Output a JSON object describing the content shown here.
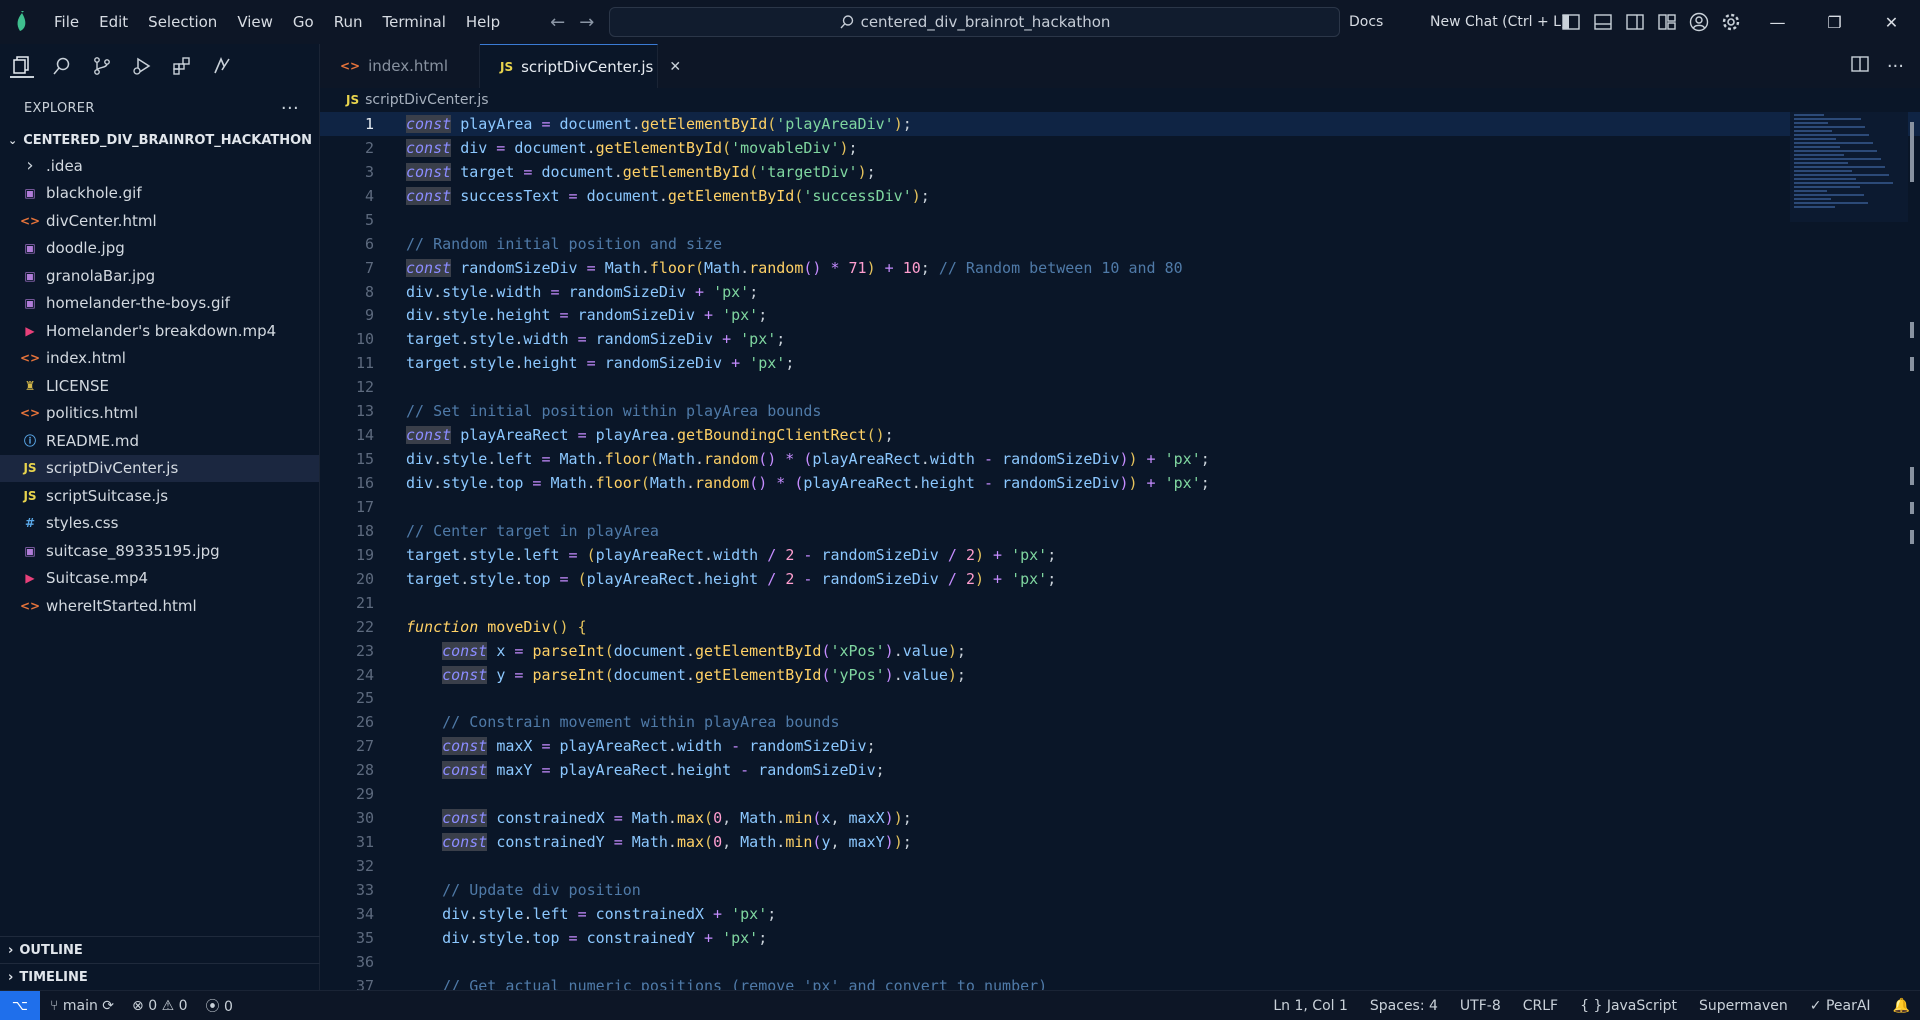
{
  "menu": [
    "File",
    "Edit",
    "Selection",
    "View",
    "Go",
    "Run",
    "Terminal",
    "Help"
  ],
  "search": {
    "text": "centered_div_brainrot_hackathon"
  },
  "header": {
    "docs": "Docs",
    "new_chat": "New Chat (Ctrl + L)"
  },
  "explorer": {
    "title": "EXPLORER",
    "more": "···",
    "folder": "CENTERED_DIV_BRAINROT_HACKATHON",
    "files": [
      {
        "name": ".idea",
        "icon": "chevron-right-icon",
        "glyph": "›",
        "color": "#c9d1d9"
      },
      {
        "name": "blackhole.gif",
        "icon": "image-icon",
        "glyph": "▣",
        "color": "#b07cd8"
      },
      {
        "name": "divCenter.html",
        "icon": "html-icon",
        "glyph": "<>",
        "color": "#e8743b"
      },
      {
        "name": "doodle.jpg",
        "icon": "image-icon",
        "glyph": "▣",
        "color": "#b07cd8"
      },
      {
        "name": "granolaBar.jpg",
        "icon": "image-icon",
        "glyph": "▣",
        "color": "#b07cd8"
      },
      {
        "name": "homelander-the-boys.gif",
        "icon": "image-icon",
        "glyph": "▣",
        "color": "#b07cd8"
      },
      {
        "name": "Homelander's breakdown.mp4",
        "icon": "video-icon",
        "glyph": "▶",
        "color": "#e8407a"
      },
      {
        "name": "index.html",
        "icon": "html-icon",
        "glyph": "<>",
        "color": "#e8743b"
      },
      {
        "name": "LICENSE",
        "icon": "license-icon",
        "glyph": "♜",
        "color": "#d4b84a"
      },
      {
        "name": "politics.html",
        "icon": "html-icon",
        "glyph": "<>",
        "color": "#e8743b"
      },
      {
        "name": "README.md",
        "icon": "info-icon",
        "glyph": "ⓘ",
        "color": "#5aa8e8"
      },
      {
        "name": "scriptDivCenter.js",
        "icon": "js-icon",
        "glyph": "JS",
        "color": "#e8d44d"
      },
      {
        "name": "scriptSuitcase.js",
        "icon": "js-icon",
        "glyph": "JS",
        "color": "#e8d44d"
      },
      {
        "name": "styles.css",
        "icon": "css-icon",
        "glyph": "#",
        "color": "#5aa8e8"
      },
      {
        "name": "suitcase_89335195.jpg",
        "icon": "image-icon",
        "glyph": "▣",
        "color": "#b07cd8"
      },
      {
        "name": "Suitcase.mp4",
        "icon": "video-icon",
        "glyph": "▶",
        "color": "#e8407a"
      },
      {
        "name": "whereItStarted.html",
        "icon": "html-icon",
        "glyph": "<>",
        "color": "#e8743b"
      }
    ],
    "outline": "OUTLINE",
    "timeline": "TIMELINE"
  },
  "tabs": [
    {
      "label": "index.html",
      "glyph": "<>",
      "color": "#e8743b",
      "active": false
    },
    {
      "label": "scriptDivCenter.js",
      "glyph": "JS",
      "color": "#e8d44d",
      "active": true
    }
  ],
  "tab_close": "✕",
  "breadcrumb": {
    "glyph": "JS",
    "file": "scriptDivCenter.js"
  },
  "code_lines": [
    [
      [
        "kw",
        "const"
      ],
      [
        "pl",
        " "
      ],
      [
        "var",
        "playArea"
      ],
      [
        "op",
        " = "
      ],
      [
        "var",
        "document"
      ],
      [
        "pl",
        "."
      ],
      [
        "fnc",
        "getElementById"
      ],
      [
        "punc",
        "("
      ],
      [
        "str",
        "'playAreaDiv'"
      ],
      [
        "punc",
        ")"
      ],
      [
        "pl",
        ";"
      ]
    ],
    [
      [
        "kw",
        "const"
      ],
      [
        "pl",
        " "
      ],
      [
        "var",
        "div"
      ],
      [
        "op",
        " = "
      ],
      [
        "var",
        "document"
      ],
      [
        "pl",
        "."
      ],
      [
        "fnc",
        "getElementById"
      ],
      [
        "punc",
        "("
      ],
      [
        "str",
        "'movableDiv'"
      ],
      [
        "punc",
        ")"
      ],
      [
        "pl",
        ";"
      ]
    ],
    [
      [
        "kw",
        "const"
      ],
      [
        "pl",
        " "
      ],
      [
        "var",
        "target"
      ],
      [
        "op",
        " = "
      ],
      [
        "var",
        "document"
      ],
      [
        "pl",
        "."
      ],
      [
        "fnc",
        "getElementById"
      ],
      [
        "punc",
        "("
      ],
      [
        "str",
        "'targetDiv'"
      ],
      [
        "punc",
        ")"
      ],
      [
        "pl",
        ";"
      ]
    ],
    [
      [
        "kw",
        "const"
      ],
      [
        "pl",
        " "
      ],
      [
        "var",
        "successText"
      ],
      [
        "op",
        " = "
      ],
      [
        "var",
        "document"
      ],
      [
        "pl",
        "."
      ],
      [
        "fnc",
        "getElementById"
      ],
      [
        "punc",
        "("
      ],
      [
        "str",
        "'successDiv'"
      ],
      [
        "punc",
        ")"
      ],
      [
        "pl",
        ";"
      ]
    ],
    [],
    [
      [
        "com",
        "// Random initial position and size"
      ]
    ],
    [
      [
        "kw",
        "const"
      ],
      [
        "pl",
        " "
      ],
      [
        "var",
        "randomSizeDiv"
      ],
      [
        "op",
        " = "
      ],
      [
        "var",
        "Math"
      ],
      [
        "pl",
        "."
      ],
      [
        "fnc",
        "floor"
      ],
      [
        "punc",
        "("
      ],
      [
        "var",
        "Math"
      ],
      [
        "pl",
        "."
      ],
      [
        "fnc",
        "random"
      ],
      [
        "op",
        "()"
      ],
      [
        "op",
        " * "
      ],
      [
        "num",
        "71"
      ],
      [
        "punc",
        ")"
      ],
      [
        "op",
        " + "
      ],
      [
        "num",
        "10"
      ],
      [
        "pl",
        "; "
      ],
      [
        "com",
        "// Random between 10 and 80"
      ]
    ],
    [
      [
        "var",
        "div"
      ],
      [
        "pl",
        "."
      ],
      [
        "prop",
        "style"
      ],
      [
        "pl",
        "."
      ],
      [
        "prop",
        "width"
      ],
      [
        "op",
        " = "
      ],
      [
        "var",
        "randomSizeDiv"
      ],
      [
        "op",
        " + "
      ],
      [
        "str",
        "'px'"
      ],
      [
        "pl",
        ";"
      ]
    ],
    [
      [
        "var",
        "div"
      ],
      [
        "pl",
        "."
      ],
      [
        "prop",
        "style"
      ],
      [
        "pl",
        "."
      ],
      [
        "prop",
        "height"
      ],
      [
        "op",
        " = "
      ],
      [
        "var",
        "randomSizeDiv"
      ],
      [
        "op",
        " + "
      ],
      [
        "str",
        "'px'"
      ],
      [
        "pl",
        ";"
      ]
    ],
    [
      [
        "var",
        "target"
      ],
      [
        "pl",
        "."
      ],
      [
        "prop",
        "style"
      ],
      [
        "pl",
        "."
      ],
      [
        "prop",
        "width"
      ],
      [
        "op",
        " = "
      ],
      [
        "var",
        "randomSizeDiv"
      ],
      [
        "op",
        " + "
      ],
      [
        "str",
        "'px'"
      ],
      [
        "pl",
        ";"
      ]
    ],
    [
      [
        "var",
        "target"
      ],
      [
        "pl",
        "."
      ],
      [
        "prop",
        "style"
      ],
      [
        "pl",
        "."
      ],
      [
        "prop",
        "height"
      ],
      [
        "op",
        " = "
      ],
      [
        "var",
        "randomSizeDiv"
      ],
      [
        "op",
        " + "
      ],
      [
        "str",
        "'px'"
      ],
      [
        "pl",
        ";"
      ]
    ],
    [],
    [
      [
        "com",
        "// Set initial position within playArea bounds"
      ]
    ],
    [
      [
        "kw",
        "const"
      ],
      [
        "pl",
        " "
      ],
      [
        "var",
        "playAreaRect"
      ],
      [
        "op",
        " = "
      ],
      [
        "var",
        "playArea"
      ],
      [
        "pl",
        "."
      ],
      [
        "fnc",
        "getBoundingClientRect"
      ],
      [
        "punc",
        "()"
      ],
      [
        "pl",
        ";"
      ]
    ],
    [
      [
        "var",
        "div"
      ],
      [
        "pl",
        "."
      ],
      [
        "prop",
        "style"
      ],
      [
        "pl",
        "."
      ],
      [
        "prop",
        "left"
      ],
      [
        "op",
        " = "
      ],
      [
        "var",
        "Math"
      ],
      [
        "pl",
        "."
      ],
      [
        "fnc",
        "floor"
      ],
      [
        "punc",
        "("
      ],
      [
        "var",
        "Math"
      ],
      [
        "pl",
        "."
      ],
      [
        "fnc",
        "random"
      ],
      [
        "op",
        "()"
      ],
      [
        "op",
        " * "
      ],
      [
        "op",
        "("
      ],
      [
        "var",
        "playAreaRect"
      ],
      [
        "pl",
        "."
      ],
      [
        "prop",
        "width"
      ],
      [
        "op",
        " - "
      ],
      [
        "var",
        "randomSizeDiv"
      ],
      [
        "op",
        ")"
      ],
      [
        "punc",
        ")"
      ],
      [
        "op",
        " + "
      ],
      [
        "str",
        "'px'"
      ],
      [
        "pl",
        ";"
      ]
    ],
    [
      [
        "var",
        "div"
      ],
      [
        "pl",
        "."
      ],
      [
        "prop",
        "style"
      ],
      [
        "pl",
        "."
      ],
      [
        "prop",
        "top"
      ],
      [
        "op",
        " = "
      ],
      [
        "var",
        "Math"
      ],
      [
        "pl",
        "."
      ],
      [
        "fnc",
        "floor"
      ],
      [
        "punc",
        "("
      ],
      [
        "var",
        "Math"
      ],
      [
        "pl",
        "."
      ],
      [
        "fnc",
        "random"
      ],
      [
        "op",
        "()"
      ],
      [
        "op",
        " * "
      ],
      [
        "op",
        "("
      ],
      [
        "var",
        "playAreaRect"
      ],
      [
        "pl",
        "."
      ],
      [
        "prop",
        "height"
      ],
      [
        "op",
        " - "
      ],
      [
        "var",
        "randomSizeDiv"
      ],
      [
        "op",
        ")"
      ],
      [
        "punc",
        ")"
      ],
      [
        "op",
        " + "
      ],
      [
        "str",
        "'px'"
      ],
      [
        "pl",
        ";"
      ]
    ],
    [],
    [
      [
        "com",
        "// Center target in playArea"
      ]
    ],
    [
      [
        "var",
        "target"
      ],
      [
        "pl",
        "."
      ],
      [
        "prop",
        "style"
      ],
      [
        "pl",
        "."
      ],
      [
        "prop",
        "left"
      ],
      [
        "op",
        " = "
      ],
      [
        "punc",
        "("
      ],
      [
        "var",
        "playAreaRect"
      ],
      [
        "pl",
        "."
      ],
      [
        "prop",
        "width"
      ],
      [
        "op",
        " / "
      ],
      [
        "num",
        "2"
      ],
      [
        "op",
        " - "
      ],
      [
        "var",
        "randomSizeDiv"
      ],
      [
        "op",
        " / "
      ],
      [
        "num",
        "2"
      ],
      [
        "punc",
        ")"
      ],
      [
        "op",
        " + "
      ],
      [
        "str",
        "'px'"
      ],
      [
        "pl",
        ";"
      ]
    ],
    [
      [
        "var",
        "target"
      ],
      [
        "pl",
        "."
      ],
      [
        "prop",
        "style"
      ],
      [
        "pl",
        "."
      ],
      [
        "prop",
        "top"
      ],
      [
        "op",
        " = "
      ],
      [
        "punc",
        "("
      ],
      [
        "var",
        "playAreaRect"
      ],
      [
        "pl",
        "."
      ],
      [
        "prop",
        "height"
      ],
      [
        "op",
        " / "
      ],
      [
        "num",
        "2"
      ],
      [
        "op",
        " - "
      ],
      [
        "var",
        "randomSizeDiv"
      ],
      [
        "op",
        " / "
      ],
      [
        "num",
        "2"
      ],
      [
        "punc",
        ")"
      ],
      [
        "op",
        " + "
      ],
      [
        "str",
        "'px'"
      ],
      [
        "pl",
        ";"
      ]
    ],
    [],
    [
      [
        "fn-kw",
        "function"
      ],
      [
        "pl",
        " "
      ],
      [
        "fnc",
        "moveDiv"
      ],
      [
        "punc",
        "() {"
      ]
    ],
    [
      [
        "pl",
        "    "
      ],
      [
        "kw",
        "const"
      ],
      [
        "pl",
        " "
      ],
      [
        "var",
        "x"
      ],
      [
        "op",
        " = "
      ],
      [
        "fnc",
        "parseInt"
      ],
      [
        "punc",
        "("
      ],
      [
        "var",
        "document"
      ],
      [
        "pl",
        "."
      ],
      [
        "fnc",
        "getElementById"
      ],
      [
        "op",
        "("
      ],
      [
        "str",
        "'xPos'"
      ],
      [
        "op",
        ")"
      ],
      [
        "pl",
        "."
      ],
      [
        "prop",
        "value"
      ],
      [
        "punc",
        ")"
      ],
      [
        "pl",
        ";"
      ]
    ],
    [
      [
        "pl",
        "    "
      ],
      [
        "kw",
        "const"
      ],
      [
        "pl",
        " "
      ],
      [
        "var",
        "y"
      ],
      [
        "op",
        " = "
      ],
      [
        "fnc",
        "parseInt"
      ],
      [
        "punc",
        "("
      ],
      [
        "var",
        "document"
      ],
      [
        "pl",
        "."
      ],
      [
        "fnc",
        "getElementById"
      ],
      [
        "op",
        "("
      ],
      [
        "str",
        "'yPos'"
      ],
      [
        "op",
        ")"
      ],
      [
        "pl",
        "."
      ],
      [
        "prop",
        "value"
      ],
      [
        "punc",
        ")"
      ],
      [
        "pl",
        ";"
      ]
    ],
    [],
    [
      [
        "pl",
        "    "
      ],
      [
        "com",
        "// Constrain movement within playArea bounds"
      ]
    ],
    [
      [
        "pl",
        "    "
      ],
      [
        "kw",
        "const"
      ],
      [
        "pl",
        " "
      ],
      [
        "var",
        "maxX"
      ],
      [
        "op",
        " = "
      ],
      [
        "var",
        "playAreaRect"
      ],
      [
        "pl",
        "."
      ],
      [
        "prop",
        "width"
      ],
      [
        "op",
        " - "
      ],
      [
        "var",
        "randomSizeDiv"
      ],
      [
        "pl",
        ";"
      ]
    ],
    [
      [
        "pl",
        "    "
      ],
      [
        "kw",
        "const"
      ],
      [
        "pl",
        " "
      ],
      [
        "var",
        "maxY"
      ],
      [
        "op",
        " = "
      ],
      [
        "var",
        "playAreaRect"
      ],
      [
        "pl",
        "."
      ],
      [
        "prop",
        "height"
      ],
      [
        "op",
        " - "
      ],
      [
        "var",
        "randomSizeDiv"
      ],
      [
        "pl",
        ";"
      ]
    ],
    [],
    [
      [
        "pl",
        "    "
      ],
      [
        "kw",
        "const"
      ],
      [
        "pl",
        " "
      ],
      [
        "var",
        "constrainedX"
      ],
      [
        "op",
        " = "
      ],
      [
        "var",
        "Math"
      ],
      [
        "pl",
        "."
      ],
      [
        "fnc",
        "max"
      ],
      [
        "punc",
        "("
      ],
      [
        "num",
        "0"
      ],
      [
        "pl",
        ", "
      ],
      [
        "var",
        "Math"
      ],
      [
        "pl",
        "."
      ],
      [
        "fnc",
        "min"
      ],
      [
        "op",
        "("
      ],
      [
        "var",
        "x"
      ],
      [
        "pl",
        ", "
      ],
      [
        "var",
        "maxX"
      ],
      [
        "op",
        ")"
      ],
      [
        "punc",
        ")"
      ],
      [
        "pl",
        ";"
      ]
    ],
    [
      [
        "pl",
        "    "
      ],
      [
        "kw",
        "const"
      ],
      [
        "pl",
        " "
      ],
      [
        "var",
        "constrainedY"
      ],
      [
        "op",
        " = "
      ],
      [
        "var",
        "Math"
      ],
      [
        "pl",
        "."
      ],
      [
        "fnc",
        "max"
      ],
      [
        "punc",
        "("
      ],
      [
        "num",
        "0"
      ],
      [
        "pl",
        ", "
      ],
      [
        "var",
        "Math"
      ],
      [
        "pl",
        "."
      ],
      [
        "fnc",
        "min"
      ],
      [
        "op",
        "("
      ],
      [
        "var",
        "y"
      ],
      [
        "pl",
        ", "
      ],
      [
        "var",
        "maxY"
      ],
      [
        "op",
        ")"
      ],
      [
        "punc",
        ")"
      ],
      [
        "pl",
        ";"
      ]
    ],
    [],
    [
      [
        "pl",
        "    "
      ],
      [
        "com",
        "// Update div position"
      ]
    ],
    [
      [
        "pl",
        "    "
      ],
      [
        "var",
        "div"
      ],
      [
        "pl",
        "."
      ],
      [
        "prop",
        "style"
      ],
      [
        "pl",
        "."
      ],
      [
        "prop",
        "left"
      ],
      [
        "op",
        " = "
      ],
      [
        "var",
        "constrainedX"
      ],
      [
        "op",
        " + "
      ],
      [
        "str",
        "'px'"
      ],
      [
        "pl",
        ";"
      ]
    ],
    [
      [
        "pl",
        "    "
      ],
      [
        "var",
        "div"
      ],
      [
        "pl",
        "."
      ],
      [
        "prop",
        "style"
      ],
      [
        "pl",
        "."
      ],
      [
        "prop",
        "top"
      ],
      [
        "op",
        " = "
      ],
      [
        "var",
        "constrainedY"
      ],
      [
        "op",
        " + "
      ],
      [
        "str",
        "'px'"
      ],
      [
        "pl",
        ";"
      ]
    ],
    [],
    [
      [
        "pl",
        "    "
      ],
      [
        "com",
        "// Get actual numeric positions (remove 'px' and convert to number)"
      ]
    ]
  ],
  "status": {
    "branch": "main",
    "errors": "0",
    "warnings": "0",
    "ports": "0",
    "position": "Ln 1, Col 1",
    "spaces": "Spaces: 4",
    "encoding": "UTF-8",
    "eol": "CRLF",
    "language_braces": "{ }",
    "language": "JavaScript",
    "supermaven": "Supermaven",
    "pearai": "PearAI"
  }
}
